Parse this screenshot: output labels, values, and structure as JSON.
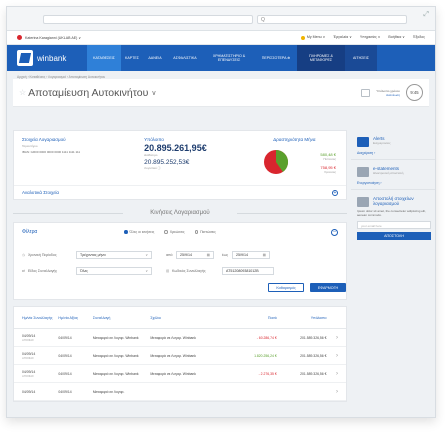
{
  "browser": {
    "search_placeholder": "Q"
  },
  "userbar": {
    "user": "Katerina Karagianni (UKLAB AE) ∨",
    "links": [
      "My Menu ∨",
      "Έργαλεία ∨",
      "Υπηρεσίες ∨",
      "Βοήθεια ∨",
      "Έξοδος"
    ]
  },
  "nav": {
    "brand": "winbank",
    "items": [
      "ΚΑΤΑΘΕΣΕΙΣ",
      "ΚΑΡΤΕΣ",
      "ΔΑΝΕΙΑ",
      "ΑΣΦΑΛΙΣΤΙΚΑ",
      "ΧΡΗΜΑΤΙΣΤΗΡΙΟ & ΕΠΕΝΔΥΣΕΙΣ",
      "ΠΕΡΙΣΣΟΤΕΡΑ ⊕",
      "ΠΛΗΡΩΜΕΣ & ΜΕΤΑΦΟΡΕΣ",
      "ΑΙΤΗΣΕΙΣ"
    ]
  },
  "breadcrumb": "Αρχική › Καταθέσεις › Λογαριασμοί › Αποταμίευση Αυτοκινήτου",
  "page": {
    "title": "Αποταμίευση Αυτοκινήτου",
    "timer_label_1": "Υπόλοιπο χρόνου",
    "timer_label_2": "Ανανέωση",
    "timer": "9:45"
  },
  "account": {
    "name": "Στοιχεία Λογαριασμού",
    "type": "Ταμιευτήριο",
    "iban": "IBAN: GR00 0000 0000 0000 1111 1111 111",
    "balance_label": "Υπόλοιπο",
    "balance": "20.895.261,95€",
    "balance_sub": "Διαθέσιμο",
    "ledger": "20.895.252,53€",
    "ledger_sub": "Λογιστικό ⓘ",
    "activity_label": "Δραστηριότητα Μήνα",
    "income": "580,48 €",
    "income_sub": "Πιστώσεις",
    "expense": "758,95 €",
    "expense_sub": "Χρεώσεις",
    "details_link": "Αναλυτικά Στοιχεία"
  },
  "colors": {
    "income": "#5aa02c",
    "expense": "#d9262e",
    "accent": "#1d5fb8"
  },
  "section_title": "Κινήσεις Λογαριασμού",
  "filters": {
    "title": "Φίλτρα",
    "radios": [
      "Όλες οι κινήσεις",
      "Χρεώσεις",
      "Πιστώσεις"
    ],
    "period_label": "Χρονική Περίοδος",
    "period_value": "Τρέχοντας μήνα",
    "from_label": "από",
    "from_value": "25/9/14",
    "to_label": "έως",
    "to_value": "25/9/14",
    "type_label": "Είδος Συναλλαγής",
    "type_value": "Όλες",
    "code_label": "Κωδικός Συναλλαγής",
    "code_value": "AT5120809381012B",
    "clear": "Καθαρισμός",
    "apply": "ΕΦΑΡΜΟΓΗ"
  },
  "table": {
    "headers": [
      "Ημ/νία Συναλλαγής",
      "Ημ/νία Αξίας",
      "Συναλλαγή",
      "Σχόλιο",
      "Ποσό",
      "Υπόλοιπο"
    ],
    "rows": [
      {
        "d1": "04/09/14",
        "d1s": "ΑΠΟΦΑΣ",
        "d2": "04/09/14",
        "tx": "Μεταφορά σε Λογαρ. Winbank",
        "note": "Μεταφορά σε Λογαρ. Winbank",
        "amount": "- 60.286,74 €",
        "sign": "neg",
        "bal": "201.589.326,56 €"
      },
      {
        "d1": "04/09/14",
        "d1s": "ΑΠΟΦΑΣ",
        "d2": "04/09/14",
        "tx": "Μεταφορά σε Λογαρ. Winbank",
        "note": "Μεταφορά σε Λογαρ. Winbank",
        "amount": "1.820.256,24 €",
        "sign": "pos",
        "bal": "201.589.326,56 €"
      },
      {
        "d1": "04/09/14",
        "d1s": "ΑΠΟΦΑΣ",
        "d2": "04/09/14",
        "tx": "Μεταφορά σε Λογαρ. Winbank",
        "note": "Μεταφορά σε Λογαρ. Winbank",
        "amount": "- 2.276,35 €",
        "sign": "neg",
        "bal": "201.589.326,56 €"
      },
      {
        "d1": "04/09/14",
        "d1s": "",
        "d2": "04/09/14",
        "tx": "Μεταφορά σε Λογαρ.",
        "note": "",
        "amount": "",
        "sign": "neg",
        "bal": ""
      }
    ]
  },
  "sidebar": {
    "alerts_title": "Alerts",
    "alerts_sub": "Ενημερώσεις",
    "alerts_link": "Διαχείριση ›",
    "estatements_title": "e-statements",
    "estatements_sub": "Ηλεκτρονική αποστολή",
    "estatements_link": "Ενεργοποίηση ›",
    "send_title": "Αποστολή στοιχείων λογαριασμού",
    "send_text": "Ipsum dolor sit amet, the consectetur adipiscing elit, aenean commodo.",
    "email_placeholder": "your email here",
    "send_button": "ΑΠΟΣΤΟΛΗ"
  }
}
